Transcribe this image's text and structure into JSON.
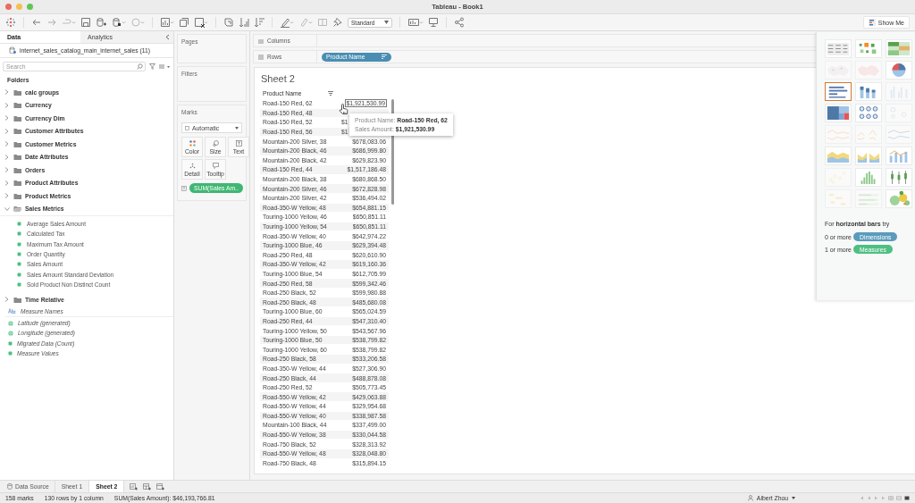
{
  "window": {
    "title": "Tableau - Book1"
  },
  "toolbar": {
    "fit_dropdown": "Standard",
    "show_me_button": "Show Me"
  },
  "data_pane": {
    "tabs": [
      {
        "label": "Data",
        "selected": true
      },
      {
        "label": "Analytics",
        "selected": false
      }
    ],
    "data_source": "internet_sales_catalog_main_internet_sales (11)",
    "search": {
      "placeholder": "Search"
    },
    "folders_heading": "Folders",
    "folders": [
      {
        "name": "calc groups",
        "expanded": false
      },
      {
        "name": "Currency",
        "expanded": false
      },
      {
        "name": "Currency Dim",
        "expanded": false
      },
      {
        "name": "Customer Attributes",
        "expanded": false
      },
      {
        "name": "Customer Metrics",
        "expanded": false
      },
      {
        "name": "Date Attributes",
        "expanded": false
      },
      {
        "name": "Orders",
        "expanded": false
      },
      {
        "name": "Product Attributes",
        "expanded": false
      },
      {
        "name": "Product Metrics",
        "expanded": false
      },
      {
        "name": "Sales Metrics",
        "expanded": true,
        "children": [
          {
            "name": "Average Sales Amount"
          },
          {
            "name": "Calculated Tax"
          },
          {
            "name": "Maximum Tax Amount"
          },
          {
            "name": "Order Quantity"
          },
          {
            "name": "Sales Amount"
          },
          {
            "name": "Sales Amount Standard Deviation"
          },
          {
            "name": "Sold Product Non Distinct Count"
          }
        ]
      },
      {
        "name": "Time Relative",
        "expanded": false
      }
    ],
    "fields": [
      {
        "name": "Measure Names",
        "kind": "text"
      },
      {
        "name": "Latitude (generated)",
        "kind": "geo"
      },
      {
        "name": "Longitude (generated)",
        "kind": "geo"
      },
      {
        "name": "Migrated Data (Count)",
        "kind": "measure"
      },
      {
        "name": "Measure Values",
        "kind": "measure"
      }
    ]
  },
  "cards": {
    "pages": "Pages",
    "filters": "Filters",
    "marks": {
      "title": "Marks",
      "mark_type": "Automatic",
      "buttons": [
        {
          "label": "Color",
          "kind": "color"
        },
        {
          "label": "Size",
          "kind": "size"
        },
        {
          "label": "Text",
          "kind": "text"
        },
        {
          "label": "Detail",
          "kind": "detail"
        },
        {
          "label": "Tooltip",
          "kind": "tooltip"
        }
      ],
      "pill": "SUM(Sales Am.."
    }
  },
  "shelves": {
    "columns": {
      "label": "Columns"
    },
    "rows": {
      "label": "Rows",
      "pill": "Product Name"
    }
  },
  "sheet": {
    "title": "Sheet 2",
    "column_header": "Product Name",
    "rows": [
      {
        "product": "Road-150 Red, 62",
        "sales": "$1,921,530.99",
        "hovered": true
      },
      {
        "product": "Road-150 Red, 48",
        "hovered": false
      },
      {
        "product": "Road-150 Red, 52",
        "sales": "$1",
        "hovered": false
      },
      {
        "product": "Road-150 Red, 56",
        "sales": "$1",
        "hovered": false
      },
      {
        "product": "Mountain-200 Silver, 38",
        "sales": "$678,083.06",
        "hovered": false
      },
      {
        "product": "Mountain-200 Black, 46",
        "sales": "$686,999.80",
        "hovered": false
      },
      {
        "product": "Mountain-200 Black, 42",
        "sales": "$629,823.90",
        "hovered": false
      },
      {
        "product": "Road-150 Red, 44",
        "sales": "$1,517,186.48",
        "hovered": false
      },
      {
        "product": "Mountain-200 Black, 38",
        "sales": "$680,868.50",
        "hovered": false
      },
      {
        "product": "Mountain-200 Silver, 46",
        "sales": "$672,828.98",
        "hovered": false
      },
      {
        "product": "Mountain-200 Silver, 42",
        "sales": "$536,494.02",
        "hovered": false
      },
      {
        "product": "Road-350-W Yellow, 48",
        "sales": "$654,881.15",
        "hovered": false
      },
      {
        "product": "Touring-1000 Yellow, 46",
        "sales": "$650,851.11",
        "hovered": false
      },
      {
        "product": "Touring-1000 Yellow, 54",
        "sales": "$650,851.11",
        "hovered": false
      },
      {
        "product": "Road-350-W Yellow, 40",
        "sales": "$642,974.22",
        "hovered": false
      },
      {
        "product": "Touring-1000 Blue, 46",
        "sales": "$629,394.48",
        "hovered": false
      },
      {
        "product": "Road-250 Red, 48",
        "sales": "$620,610.90",
        "hovered": false
      },
      {
        "product": "Road-350-W Yellow, 42",
        "sales": "$619,160.36",
        "hovered": false
      },
      {
        "product": "Touring-1000 Blue, 54",
        "sales": "$612,705.99",
        "hovered": false
      },
      {
        "product": "Road-250 Red, 58",
        "sales": "$599,342.46",
        "hovered": false
      },
      {
        "product": "Road-250 Black, 52",
        "sales": "$599,980.88",
        "hovered": false
      },
      {
        "product": "Road-250 Black, 48",
        "sales": "$485,680.08",
        "hovered": false
      },
      {
        "product": "Touring-1000 Blue, 60",
        "sales": "$565,024.59",
        "hovered": false
      },
      {
        "product": "Road-250 Red, 44",
        "sales": "$547,310.40",
        "hovered": false
      },
      {
        "product": "Touring-1000 Yellow, 50",
        "sales": "$543,567.96",
        "hovered": false
      },
      {
        "product": "Touring-1000 Blue, 50",
        "sales": "$538,799.82",
        "hovered": false
      },
      {
        "product": "Touring-1000 Yellow, 60",
        "sales": "$538,799.82",
        "hovered": false
      },
      {
        "product": "Road-250 Black, 58",
        "sales": "$533,206.58",
        "hovered": false
      },
      {
        "product": "Road-350-W Yellow, 44",
        "sales": "$527,306.90",
        "hovered": false
      },
      {
        "product": "Road-250 Black, 44",
        "sales": "$488,878.08",
        "hovered": false
      },
      {
        "product": "Road-250 Red, 52",
        "sales": "$505,773.45",
        "hovered": false
      },
      {
        "product": "Road-550-W Yellow, 42",
        "sales": "$429,063.88",
        "hovered": false
      },
      {
        "product": "Road-550-W Yellow, 44",
        "sales": "$329,954.68",
        "hovered": false
      },
      {
        "product": "Road-550-W Yellow, 40",
        "sales": "$338,987.58",
        "hovered": false
      },
      {
        "product": "Mountain-100 Black, 44",
        "sales": "$337,499.00",
        "hovered": false
      },
      {
        "product": "Road-550-W Yellow, 38",
        "sales": "$330,044.58",
        "hovered": false
      },
      {
        "product": "Road-750 Black, 52",
        "sales": "$328,313.92",
        "hovered": false
      },
      {
        "product": "Road-550-W Yellow, 48",
        "sales": "$328,048.80",
        "hovered": false
      },
      {
        "product": "Road-750 Black, 48",
        "sales": "$315,894.15",
        "hovered": false
      }
    ]
  },
  "tooltip": {
    "lines": [
      {
        "label": "Product Name:",
        "value": "Road-150 Red, 62"
      },
      {
        "label": "Sales Amount:",
        "value": "$1,921,530.99"
      }
    ]
  },
  "show_me": {
    "charts": [
      {
        "kind": "text-table",
        "selected": false,
        "disabled": false
      },
      {
        "kind": "heat-map",
        "selected": false,
        "disabled": false
      },
      {
        "kind": "highlight-table",
        "selected": false,
        "disabled": false
      },
      {
        "kind": "symbol-map",
        "selected": false,
        "disabled": true
      },
      {
        "kind": "filled-map",
        "selected": false,
        "disabled": true
      },
      {
        "kind": "pie",
        "selected": false,
        "disabled": false
      },
      {
        "kind": "horizontal-bars",
        "selected": true,
        "disabled": false
      },
      {
        "kind": "stacked-bars",
        "selected": false,
        "disabled": false
      },
      {
        "kind": "side-by-side-bars",
        "selected": false,
        "disabled": true
      },
      {
        "kind": "treemap",
        "selected": false,
        "disabled": false
      },
      {
        "kind": "circle-view",
        "selected": false,
        "disabled": false
      },
      {
        "kind": "side-by-side-circles",
        "selected": false,
        "disabled": true
      },
      {
        "kind": "continuous-lines",
        "selected": false,
        "disabled": true
      },
      {
        "kind": "discrete-lines",
        "selected": false,
        "disabled": true
      },
      {
        "kind": "dual-lines",
        "selected": false,
        "disabled": true
      },
      {
        "kind": "continuous-area",
        "selected": false,
        "disabled": false
      },
      {
        "kind": "discrete-area",
        "selected": false,
        "disabled": false
      },
      {
        "kind": "dual-combination",
        "selected": false,
        "disabled": false
      },
      {
        "kind": "scatter",
        "selected": false,
        "disabled": true
      },
      {
        "kind": "histogram",
        "selected": false,
        "disabled": false
      },
      {
        "kind": "box-plot",
        "selected": false,
        "disabled": false
      },
      {
        "kind": "gantt",
        "selected": false,
        "disabled": true
      },
      {
        "kind": "bullet",
        "selected": false,
        "disabled": true
      },
      {
        "kind": "packed-bubbles",
        "selected": false,
        "disabled": false
      }
    ],
    "hint": "For **horizontal bars** try",
    "requirements": [
      {
        "prefix": "0 or more",
        "pill": "Dimensions",
        "kind": "dimension"
      },
      {
        "prefix": "1 or more",
        "pill": "Measures",
        "kind": "measure"
      }
    ]
  },
  "sheet_tabs": [
    {
      "label": "Data Source",
      "kind": "data-source",
      "selected": false
    },
    {
      "label": "Sheet 1",
      "kind": "sheet",
      "selected": false
    },
    {
      "label": "Sheet 2",
      "kind": "sheet",
      "selected": true
    }
  ],
  "status_bar": {
    "marks": "158 marks",
    "dimensions": "130 rows by 1 column",
    "summary": "SUM(Sales Amount): $46,193,766.81",
    "user": "Albert Zhou"
  }
}
